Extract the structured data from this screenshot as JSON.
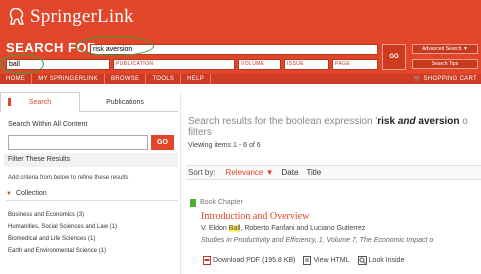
{
  "logo": {
    "text": "SpringerLink"
  },
  "search": {
    "label": "SEARCH FOR",
    "query_value": "risk aversion",
    "author_value": "ball",
    "publication_placeholder": "PUBLICATION",
    "volume_placeholder": "VOLUME",
    "issue_placeholder": "ISSUE",
    "page_placeholder": "PAGE",
    "go_label": "GO",
    "advanced_label": "Advanced Search ▼",
    "tips_label": "Search Tips"
  },
  "nav": {
    "items": [
      "HOME",
      "MY SPRINGERLINK",
      "BROWSE",
      "TOOLS",
      "HELP"
    ],
    "cart_label": "SHOPPING CART"
  },
  "tabs": [
    "Search",
    "Publications"
  ],
  "left_panel": {
    "title": "Search Within All Content",
    "go_label": "GO",
    "filter_title": "Filter These Results",
    "add_criteria": "Add criteria from below to refine these results",
    "collection_label": "Collection",
    "collections": [
      "Business and Economics (3)",
      "Humanities, Social Sciences and Law (1)",
      "Biomedical and Life Sciences (1)",
      "Earth and Environmental Science (1)"
    ]
  },
  "results": {
    "header_prefix": "Search results for the boolean expression '",
    "header_q1": "risk",
    "header_and": " and ",
    "header_q2": "aversion",
    "header_suffix": " o",
    "header_line2": "filters",
    "viewing": "Viewing items 1 - 6 of 6",
    "sort_label": "Sort by:",
    "sort_relevance": "Relevance ▼",
    "sort_date": "Date",
    "sort_title": "Title",
    "item": {
      "type": "Book Chapter",
      "title": "Introduction and Overview",
      "authors_pre": "V. Eldon ",
      "authors_hl": "Ball",
      "authors_post": ", Roberto Fanfani and Luciano Gutierrez",
      "series": "Studies in Productivity and Efficiency, 1, Volume 7, The Economic Impact o",
      "download": "Download PDF (195.8 KB)",
      "view_html": "View HTML",
      "look_inside": "Look Inside"
    }
  },
  "colors": {
    "brand": "#e1462a",
    "highlight": "#fff26d",
    "annotation": "#3aa23a"
  }
}
